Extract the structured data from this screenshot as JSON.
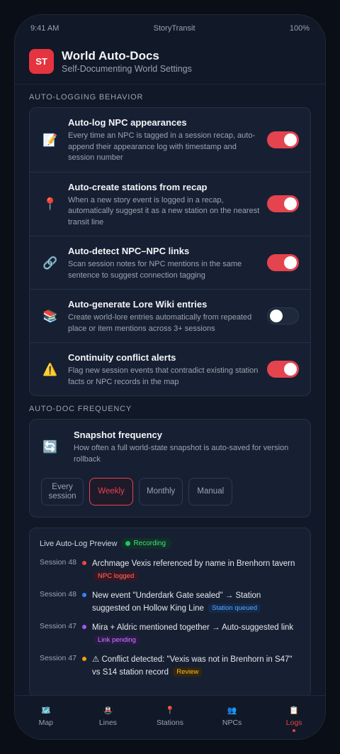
{
  "status": {
    "time": "9:41 AM",
    "carrier": "StoryTransit",
    "battery": "100%"
  },
  "header": {
    "logo": "ST",
    "title": "World Auto-Docs",
    "subtitle": "Self-Documenting World Settings"
  },
  "auto_logging": {
    "label": "AUTO-LOGGING BEHAVIOR",
    "items": [
      {
        "icon": "📝",
        "icon_name": "memo-icon",
        "title": "Auto-log NPC appearances",
        "desc": "Every time an NPC is tagged in a session recap, auto-append their appearance log with timestamp and session number",
        "on": true
      },
      {
        "icon": "📍",
        "icon_name": "pin-icon",
        "title": "Auto-create stations from recap",
        "desc": "When a new story event is logged in a recap, automatically suggest it as a new station on the nearest transit line",
        "on": true
      },
      {
        "icon": "🔗",
        "icon_name": "link-icon",
        "title": "Auto-detect NPC–NPC links",
        "desc": "Scan session notes for NPC mentions in the same sentence to suggest connection tagging",
        "on": true
      },
      {
        "icon": "📚",
        "icon_name": "books-icon",
        "title": "Auto-generate Lore Wiki entries",
        "desc": "Create world-lore entries automatically from repeated place or item mentions across 3+ sessions",
        "on": false
      },
      {
        "icon": "⚠️",
        "icon_name": "warning-icon",
        "title": "Continuity conflict alerts",
        "desc": "Flag new session events that contradict existing station facts or NPC records in the map",
        "on": true
      }
    ]
  },
  "frequency": {
    "label": "AUTO-DOC FREQUENCY",
    "icon": "🔄",
    "title": "Snapshot frequency",
    "desc": "How often a full world-state snapshot is auto-saved for version rollback",
    "options": [
      "Every session",
      "Weekly",
      "Monthly",
      "Manual"
    ],
    "selected": "Weekly"
  },
  "preview": {
    "title": "Live Auto-Log Preview",
    "badge": "Recording",
    "items": [
      {
        "session": "Session 48",
        "color": "#ef4444",
        "text": "Archmage Vexis referenced by name in Brenhorn tavern",
        "tag": "NPC logged",
        "tag_bg": "#3a1620",
        "tag_fg": "#f87171"
      },
      {
        "session": "Session 48",
        "color": "#3b82f6",
        "text": "New event \"Underdark Gate sealed\" → Station suggested on Hollow King Line",
        "tag": "Station queued",
        "tag_bg": "#132a4a",
        "tag_fg": "#60a5fa"
      },
      {
        "session": "Session 47",
        "color": "#a855f7",
        "text": "Mira + Aldric mentioned together → Auto-suggested link",
        "tag": "Link pending",
        "tag_bg": "#2a1a45",
        "tag_fg": "#c084fc"
      },
      {
        "session": "Session 47",
        "color": "#f59e0b",
        "text": "⚠ Conflict detected: \"Vexis was not in Brenhorn in S47\" vs S14 station record",
        "tag": "Review",
        "tag_bg": "#33260f",
        "tag_fg": "#fbbf24"
      }
    ]
  },
  "tabs": [
    {
      "label": "Map",
      "icon": "🗺️",
      "icon_name": "map-icon"
    },
    {
      "label": "Lines",
      "icon": "🚇",
      "icon_name": "metro-icon"
    },
    {
      "label": "Stations",
      "icon": "📍",
      "icon_name": "pin-icon"
    },
    {
      "label": "NPCs",
      "icon": "👥",
      "icon_name": "people-icon"
    },
    {
      "label": "Logs",
      "icon": "📋",
      "icon_name": "clipboard-icon",
      "active": true
    }
  ]
}
